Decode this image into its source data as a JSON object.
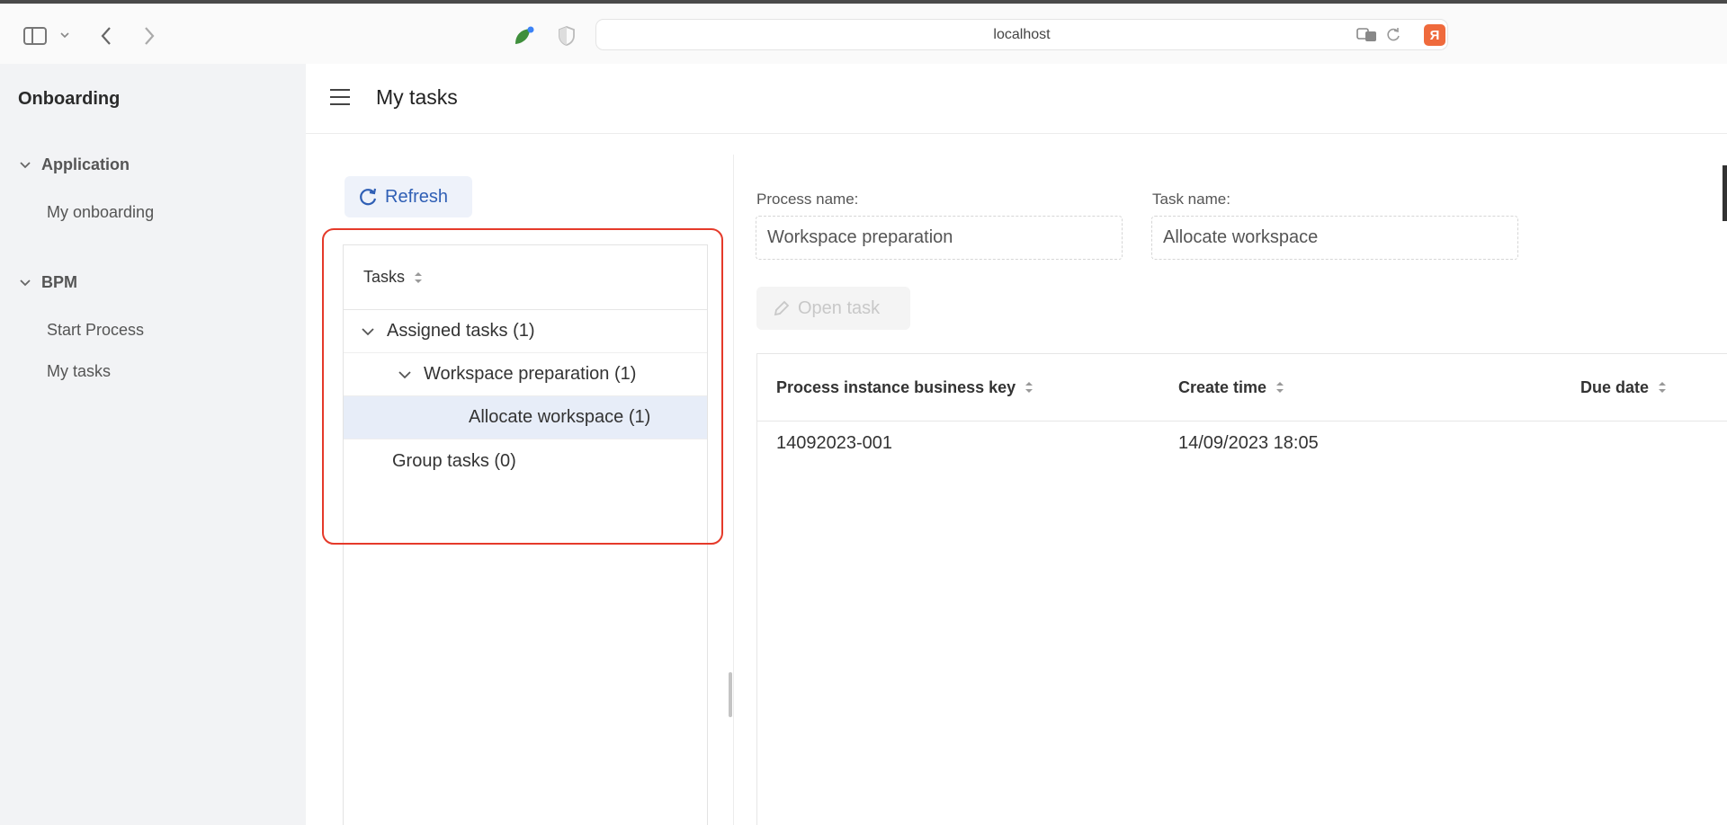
{
  "browser": {
    "url": "localhost",
    "extension_badge": "Я"
  },
  "sidebar": {
    "app_title": "Onboarding",
    "groups": [
      {
        "label": "Application",
        "items": [
          {
            "label": "My onboarding"
          }
        ]
      },
      {
        "label": "BPM",
        "items": [
          {
            "label": "Start Process"
          },
          {
            "label": "My tasks"
          }
        ]
      }
    ]
  },
  "header": {
    "title": "My tasks"
  },
  "tasks_panel": {
    "refresh_label": "Refresh",
    "column_header": "Tasks",
    "tree": [
      {
        "label": "Assigned tasks (1)",
        "level": 0,
        "expanded": true
      },
      {
        "label": "Workspace preparation (1)",
        "level": 1,
        "expanded": true
      },
      {
        "label": "Allocate workspace (1)",
        "level": 2,
        "selected": true
      },
      {
        "label": "Group tasks (0)",
        "level": 0
      }
    ]
  },
  "details": {
    "process_name_label": "Process name:",
    "process_name_value": "Workspace preparation",
    "task_name_label": "Task name:",
    "task_name_value": "Allocate workspace",
    "open_task_label": "Open task"
  },
  "table": {
    "columns": [
      "Process instance business key",
      "Create time",
      "Due date"
    ],
    "rows": [
      {
        "business_key": "14092023-001",
        "create_time": "14/09/2023 18:05",
        "due_date": ""
      }
    ]
  },
  "colors": {
    "accent": "#2f5fb5",
    "selected_row": "#e7edf8",
    "highlight_frame": "#e53a2a",
    "sidebar_bg": "#f2f3f5"
  }
}
